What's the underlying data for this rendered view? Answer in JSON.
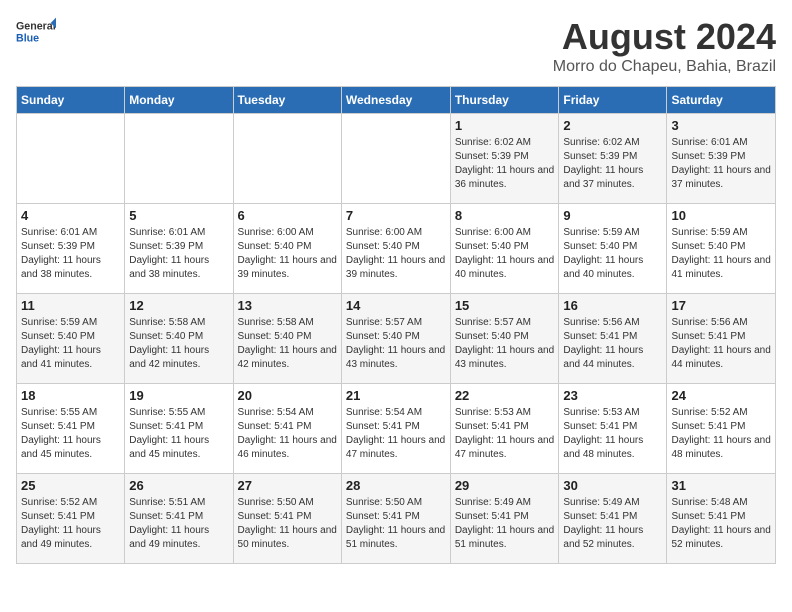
{
  "header": {
    "logo_general": "General",
    "logo_blue": "Blue",
    "title": "August 2024",
    "subtitle": "Morro do Chapeu, Bahia, Brazil"
  },
  "days_of_week": [
    "Sunday",
    "Monday",
    "Tuesday",
    "Wednesday",
    "Thursday",
    "Friday",
    "Saturday"
  ],
  "weeks": [
    [
      {
        "day": "",
        "info": ""
      },
      {
        "day": "",
        "info": ""
      },
      {
        "day": "",
        "info": ""
      },
      {
        "day": "",
        "info": ""
      },
      {
        "day": "1",
        "info": "Sunrise: 6:02 AM\nSunset: 5:39 PM\nDaylight: 11 hours and 36 minutes."
      },
      {
        "day": "2",
        "info": "Sunrise: 6:02 AM\nSunset: 5:39 PM\nDaylight: 11 hours and 37 minutes."
      },
      {
        "day": "3",
        "info": "Sunrise: 6:01 AM\nSunset: 5:39 PM\nDaylight: 11 hours and 37 minutes."
      }
    ],
    [
      {
        "day": "4",
        "info": "Sunrise: 6:01 AM\nSunset: 5:39 PM\nDaylight: 11 hours and 38 minutes."
      },
      {
        "day": "5",
        "info": "Sunrise: 6:01 AM\nSunset: 5:39 PM\nDaylight: 11 hours and 38 minutes."
      },
      {
        "day": "6",
        "info": "Sunrise: 6:00 AM\nSunset: 5:40 PM\nDaylight: 11 hours and 39 minutes."
      },
      {
        "day": "7",
        "info": "Sunrise: 6:00 AM\nSunset: 5:40 PM\nDaylight: 11 hours and 39 minutes."
      },
      {
        "day": "8",
        "info": "Sunrise: 6:00 AM\nSunset: 5:40 PM\nDaylight: 11 hours and 40 minutes."
      },
      {
        "day": "9",
        "info": "Sunrise: 5:59 AM\nSunset: 5:40 PM\nDaylight: 11 hours and 40 minutes."
      },
      {
        "day": "10",
        "info": "Sunrise: 5:59 AM\nSunset: 5:40 PM\nDaylight: 11 hours and 41 minutes."
      }
    ],
    [
      {
        "day": "11",
        "info": "Sunrise: 5:59 AM\nSunset: 5:40 PM\nDaylight: 11 hours and 41 minutes."
      },
      {
        "day": "12",
        "info": "Sunrise: 5:58 AM\nSunset: 5:40 PM\nDaylight: 11 hours and 42 minutes."
      },
      {
        "day": "13",
        "info": "Sunrise: 5:58 AM\nSunset: 5:40 PM\nDaylight: 11 hours and 42 minutes."
      },
      {
        "day": "14",
        "info": "Sunrise: 5:57 AM\nSunset: 5:40 PM\nDaylight: 11 hours and 43 minutes."
      },
      {
        "day": "15",
        "info": "Sunrise: 5:57 AM\nSunset: 5:40 PM\nDaylight: 11 hours and 43 minutes."
      },
      {
        "day": "16",
        "info": "Sunrise: 5:56 AM\nSunset: 5:41 PM\nDaylight: 11 hours and 44 minutes."
      },
      {
        "day": "17",
        "info": "Sunrise: 5:56 AM\nSunset: 5:41 PM\nDaylight: 11 hours and 44 minutes."
      }
    ],
    [
      {
        "day": "18",
        "info": "Sunrise: 5:55 AM\nSunset: 5:41 PM\nDaylight: 11 hours and 45 minutes."
      },
      {
        "day": "19",
        "info": "Sunrise: 5:55 AM\nSunset: 5:41 PM\nDaylight: 11 hours and 45 minutes."
      },
      {
        "day": "20",
        "info": "Sunrise: 5:54 AM\nSunset: 5:41 PM\nDaylight: 11 hours and 46 minutes."
      },
      {
        "day": "21",
        "info": "Sunrise: 5:54 AM\nSunset: 5:41 PM\nDaylight: 11 hours and 47 minutes."
      },
      {
        "day": "22",
        "info": "Sunrise: 5:53 AM\nSunset: 5:41 PM\nDaylight: 11 hours and 47 minutes."
      },
      {
        "day": "23",
        "info": "Sunrise: 5:53 AM\nSunset: 5:41 PM\nDaylight: 11 hours and 48 minutes."
      },
      {
        "day": "24",
        "info": "Sunrise: 5:52 AM\nSunset: 5:41 PM\nDaylight: 11 hours and 48 minutes."
      }
    ],
    [
      {
        "day": "25",
        "info": "Sunrise: 5:52 AM\nSunset: 5:41 PM\nDaylight: 11 hours and 49 minutes."
      },
      {
        "day": "26",
        "info": "Sunrise: 5:51 AM\nSunset: 5:41 PM\nDaylight: 11 hours and 49 minutes."
      },
      {
        "day": "27",
        "info": "Sunrise: 5:50 AM\nSunset: 5:41 PM\nDaylight: 11 hours and 50 minutes."
      },
      {
        "day": "28",
        "info": "Sunrise: 5:50 AM\nSunset: 5:41 PM\nDaylight: 11 hours and 51 minutes."
      },
      {
        "day": "29",
        "info": "Sunrise: 5:49 AM\nSunset: 5:41 PM\nDaylight: 11 hours and 51 minutes."
      },
      {
        "day": "30",
        "info": "Sunrise: 5:49 AM\nSunset: 5:41 PM\nDaylight: 11 hours and 52 minutes."
      },
      {
        "day": "31",
        "info": "Sunrise: 5:48 AM\nSunset: 5:41 PM\nDaylight: 11 hours and 52 minutes."
      }
    ]
  ]
}
